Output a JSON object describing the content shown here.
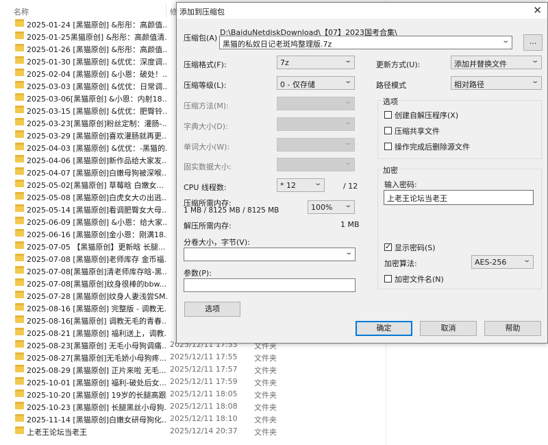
{
  "explorer": {
    "col_name": "名称",
    "col_modified": "修",
    "rows": [
      {
        "name": "2025-01-24 [黑猫原创] &彤彤：高颜值...",
        "date": "",
        "type": ""
      },
      {
        "name": "2025-01-25黑猫原创] &彤彤：高颜值清...",
        "date": "",
        "type": ""
      },
      {
        "name": "2025-01-26 [黑猫原创] &彤彤：高颜值...",
        "date": "",
        "type": ""
      },
      {
        "name": "2025-01-30 [黑猫原创] &优优：深度调...",
        "date": "",
        "type": ""
      },
      {
        "name": "2025-02-04 [黑猫原创] &小恩：破处！...",
        "date": "",
        "type": ""
      },
      {
        "name": "2025-03-03 [黑猫原创] &优优：日常调...",
        "date": "",
        "type": ""
      },
      {
        "name": "2025-03-06[黑猫原创] &小恩：内射18...",
        "date": "",
        "type": ""
      },
      {
        "name": "2025-03-15 [黑猫原创] &优优：肥臀铃...",
        "date": "",
        "type": ""
      },
      {
        "name": "2025-03-23[黑猫原创]粉丝定制：灌肠-...",
        "date": "",
        "type": ""
      },
      {
        "name": "2025-03-29 [黑猫原创]喜欢灌肠就再更...",
        "date": "",
        "type": ""
      },
      {
        "name": "2025-04-03 [黑猫原创] &优优：-黑猫的...",
        "date": "",
        "type": ""
      },
      {
        "name": "2025-04-06 [黑猫原创]新作品给大家发...",
        "date": "",
        "type": ""
      },
      {
        "name": "2025-04-07 [黑猫原创]白嫩母狗被深喉...",
        "date": "",
        "type": ""
      },
      {
        "name": "2025-05-02[黑猫原创] 草莓晗 白嫩女...",
        "date": "",
        "type": ""
      },
      {
        "name": "2025-05-08 [黑猫原创]白虎女大の出逃...",
        "date": "",
        "type": ""
      },
      {
        "name": "2025-05-14 [黑猫原创]看调肥臀女大母...",
        "date": "",
        "type": ""
      },
      {
        "name": "2025-06-09 [黑猫原创] &小恩：给大家...",
        "date": "",
        "type": ""
      },
      {
        "name": "2025-06-16 [黑猫原创]金小恩：刚满18...",
        "date": "",
        "type": ""
      },
      {
        "name": "2025-07-05 【黑猫原创】更新晗 长腿...",
        "date": "",
        "type": ""
      },
      {
        "name": "2025-07-08 [黑猫原创]老师库存 金币福...",
        "date": "",
        "type": ""
      },
      {
        "name": "2025-07-08[黑猫原创]清老师库存晗-黑...",
        "date": "",
        "type": ""
      },
      {
        "name": "2025-07-08[黑猫原创]纹身很棒的bbw...",
        "date": "",
        "type": ""
      },
      {
        "name": "2025-07-28 [黑猫原创]纹身人妻浅尝SM...",
        "date": "",
        "type": ""
      },
      {
        "name": "2025-08-16 [黑猫原创] 完整版 - 调教无...",
        "date": "",
        "type": ""
      },
      {
        "name": "2025-08-16[黑猫原创] 调教无毛的青春...",
        "date": "",
        "type": ""
      },
      {
        "name": "2025-08-21 [黑猫原创] 福利送上，调教...",
        "date": "",
        "type": ""
      },
      {
        "name": "2025-08-23[黑猫原创] 无毛小母狗调痛...",
        "date": "2025/12/11 17:53",
        "type": "文件夹"
      },
      {
        "name": "2025-08-27[黑猫原创]无毛娇小母狗疼...",
        "date": "2025/12/11 17:55",
        "type": "文件夹"
      },
      {
        "name": "2025-08-29 [黑猫原创] 正片来啦 无毛...",
        "date": "2025/12/11 17:57",
        "type": "文件夹"
      },
      {
        "name": "2025-10-01 [黑猫原创] 福利-破处后女...",
        "date": "2025/12/11 17:59",
        "type": "文件夹"
      },
      {
        "name": "2025-10-20 [黑猫原创] 19岁的长腿高跟...",
        "date": "2025/12/11 18:05",
        "type": "文件夹"
      },
      {
        "name": "2025-10-23 [黑猫原创] 长腿黑丝小母狗...",
        "date": "2025/12/11 18:08",
        "type": "文件夹"
      },
      {
        "name": "2025-11-14 [黑猫原创]白嫩女研母狗化...",
        "date": "2025/12/11 18:10",
        "type": "文件夹"
      },
      {
        "name": "上老王论坛当老王",
        "date": "2025/12/14 20:37",
        "type": "文件夹"
      }
    ]
  },
  "dialog": {
    "title": "添加到压缩包",
    "archive_label": "压缩包(A)",
    "archive_path": "D:\\BaiduNetdiskDownload\\【07】2023国考合集\\",
    "archive_name": "黑猫的私奴日记老斑鸠整理版.7z",
    "browse_label": "...",
    "format_label": "压缩格式(F):",
    "format_value": "7z",
    "level_label": "压缩等级(L):",
    "level_value": "0 - 仅存储",
    "method_label": "压缩方法(M):",
    "dict_label": "字典大小(D):",
    "word_label": "单词大小(W):",
    "solid_label": "固实数据大小:",
    "threads_label": "CPU 线程数:",
    "threads_value": "* 12",
    "threads_total": "/ 12",
    "mem_comp_label": "压缩所需内存:",
    "mem_comp_value": "1 MB / 8125 MB / 8125 MB",
    "mem_percent": "100%",
    "mem_decomp_label": "解压所需内存:",
    "mem_decomp_value": "1 MB",
    "split_label": "分卷大小，字节(V):",
    "params_label": "参数(P):",
    "options_button": "选项",
    "update_label": "更新方式(U):",
    "update_value": "添加并替换文件",
    "path_label": "路径模式",
    "path_value": "相对路径",
    "options_group": "选项",
    "opt_sfx": "创建自解压程序(X)",
    "opt_shared": "压缩共享文件",
    "opt_delete": "操作完成后删除源文件",
    "encrypt_group": "加密",
    "password_label": "输入密码:",
    "password_value": "上老王论坛当老王",
    "show_password": "显示密码(S)",
    "enc_method_label": "加密算法:",
    "enc_method_value": "AES-256",
    "enc_names": "加密文件名(N)",
    "ok": "确定",
    "cancel": "取消",
    "help": "帮助"
  }
}
